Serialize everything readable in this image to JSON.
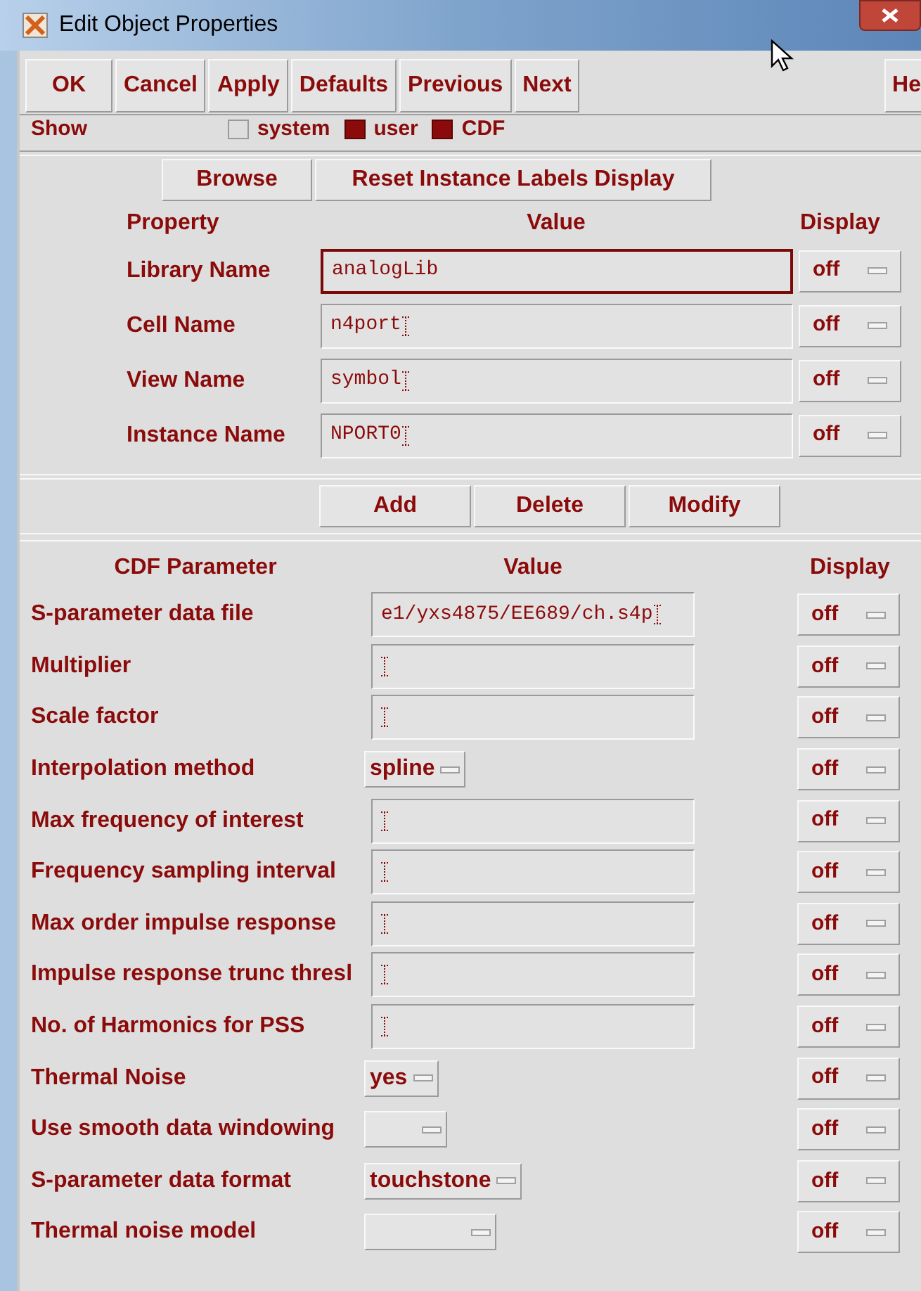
{
  "window": {
    "title": "Edit Object Properties"
  },
  "toolbar": [
    "OK",
    "Cancel",
    "Apply",
    "Defaults",
    "Previous",
    "Next"
  ],
  "help_button": "He",
  "show": {
    "label": "Show",
    "options": [
      {
        "label": "system",
        "checked": false
      },
      {
        "label": "user",
        "checked": true
      },
      {
        "label": "CDF",
        "checked": true
      }
    ]
  },
  "instance_buttons": [
    "Browse",
    "Reset Instance Labels Display"
  ],
  "property_headers": [
    "Property",
    "Value",
    "Display"
  ],
  "properties": [
    {
      "name": "Library Name",
      "value": "analogLib",
      "focused": true,
      "display": "off"
    },
    {
      "name": "Cell Name",
      "value": "n4port",
      "focused": false,
      "display": "off"
    },
    {
      "name": "View Name",
      "value": "symbol",
      "focused": false,
      "display": "off"
    },
    {
      "name": "Instance Name",
      "value": "NPORT0",
      "focused": false,
      "display": "off"
    }
  ],
  "edit_buttons": [
    "Add",
    "Delete",
    "Modify"
  ],
  "cdf_headers": [
    "CDF Parameter",
    "Value",
    "Display"
  ],
  "cdf_parameters": [
    {
      "name": "S-parameter data file",
      "kind": "field",
      "value": "e1/yxs4875/EE689/ch.s4p",
      "display": "off"
    },
    {
      "name": "Multiplier",
      "kind": "field",
      "display": "off"
    },
    {
      "name": "Scale factor",
      "kind": "field",
      "display": "off"
    },
    {
      "name": "Interpolation method",
      "kind": "cyclic",
      "value": "spline",
      "display": "off"
    },
    {
      "name": "Max frequency of interest",
      "kind": "field",
      "display": "off"
    },
    {
      "name": "Frequency sampling interval",
      "kind": "field",
      "display": "off"
    },
    {
      "name": "Max order impulse response",
      "kind": "field",
      "display": "off"
    },
    {
      "name": "Impulse response trunc thresl",
      "kind": "field",
      "display": "off"
    },
    {
      "name": "No. of Harmonics for PSS",
      "kind": "field",
      "display": "off"
    },
    {
      "name": "Thermal Noise",
      "kind": "cyclic",
      "value": "yes",
      "display": "off"
    },
    {
      "name": "Use smooth data windowing",
      "kind": "cyclic",
      "display": "off"
    },
    {
      "name": "S-parameter data format",
      "kind": "cyclic",
      "value": "touchstone",
      "display": "off"
    },
    {
      "name": "Thermal noise model",
      "kind": "cyclic",
      "wide": true,
      "display": "off"
    }
  ]
}
